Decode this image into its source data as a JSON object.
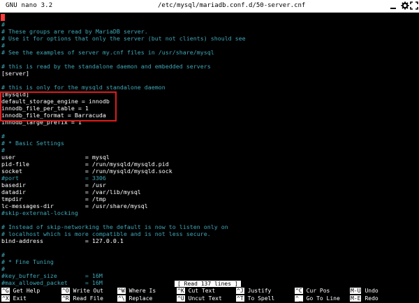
{
  "titlebar": {
    "version": "GNU nano 3.2",
    "file_path": "/etc/mysql/mariadb.conf.d/50-server.cnf"
  },
  "editor": {
    "lines": [
      {
        "text": "#",
        "type": "comment"
      },
      {
        "text": "# These groups are read by MariaDB server.",
        "type": "comment"
      },
      {
        "text": "# Use it for options that only the server (but not clients) should see",
        "type": "comment"
      },
      {
        "text": "#",
        "type": "comment"
      },
      {
        "text": "# See the examples of server my.cnf files in /usr/share/mysql",
        "type": "comment"
      },
      {
        "text": "",
        "type": "blank"
      },
      {
        "text": "# this is read by the standalone daemon and embedded servers",
        "type": "comment"
      },
      {
        "text": "[server]",
        "type": "text"
      },
      {
        "text": "",
        "type": "blank"
      },
      {
        "text": "# this is only for the mysqld standalone daemon",
        "type": "comment"
      },
      {
        "text": "[mysqld]",
        "type": "text"
      },
      {
        "text": "default_storage_engine = innodb",
        "type": "text"
      },
      {
        "text": "innodb_file_per_table = 1",
        "type": "text"
      },
      {
        "text": "innodb_file_format = Barracuda",
        "type": "text"
      },
      {
        "text": "innodb_large_prefix = 1",
        "type": "text"
      },
      {
        "text": "",
        "type": "blank"
      },
      {
        "text": "#",
        "type": "comment"
      },
      {
        "text": "# * Basic Settings",
        "type": "comment"
      },
      {
        "text": "#",
        "type": "comment"
      },
      {
        "text": "user                    = mysql",
        "type": "text"
      },
      {
        "text": "pid-file                = /run/mysqld/mysqld.pid",
        "type": "text"
      },
      {
        "text": "socket                  = /run/mysqld/mysqld.sock",
        "type": "text"
      },
      {
        "text": "#port                   = 3306",
        "type": "comment"
      },
      {
        "text": "basedir                 = /usr",
        "type": "text"
      },
      {
        "text": "datadir                 = /var/lib/mysql",
        "type": "text"
      },
      {
        "text": "tmpdir                  = /tmp",
        "type": "text"
      },
      {
        "text": "lc-messages-dir         = /usr/share/mysql",
        "type": "text"
      },
      {
        "text": "#skip-external-locking",
        "type": "comment"
      },
      {
        "text": "",
        "type": "blank"
      },
      {
        "text": "# Instead of skip-networking the default is now to listen only on",
        "type": "comment"
      },
      {
        "text": "# localhost which is more compatible and is not less secure.",
        "type": "comment"
      },
      {
        "text": "bind-address            = 127.0.0.1",
        "type": "text"
      },
      {
        "text": "",
        "type": "blank"
      },
      {
        "text": "#",
        "type": "comment"
      },
      {
        "text": "# * Fine Tuning",
        "type": "comment"
      },
      {
        "text": "#",
        "type": "comment"
      },
      {
        "text": "#key_buffer_size        = 16M",
        "type": "comment"
      },
      {
        "text": "#max_allowed_packet     = 16M",
        "type": "comment"
      }
    ]
  },
  "status_message": "[ Read 137 lines ]",
  "shortcuts": [
    {
      "key": "^G",
      "label": "Get Help",
      "name": "get-help"
    },
    {
      "key": "^O",
      "label": "Write Out",
      "name": "write-out"
    },
    {
      "key": "^W",
      "label": "Where Is",
      "name": "where-is"
    },
    {
      "key": "^K",
      "label": "Cut Text",
      "name": "cut-text"
    },
    {
      "key": "^J",
      "label": "Justify",
      "name": "justify"
    },
    {
      "key": "^C",
      "label": "Cur Pos",
      "name": "cur-pos"
    },
    {
      "key": "M-U",
      "label": "Undo",
      "name": "undo"
    },
    {
      "key": "^X",
      "label": "Exit",
      "name": "exit"
    },
    {
      "key": "^R",
      "label": "Read File",
      "name": "read-file"
    },
    {
      "key": "^\\",
      "label": "Replace",
      "name": "replace"
    },
    {
      "key": "^U",
      "label": "Uncut Text",
      "name": "uncut-text"
    },
    {
      "key": "^T",
      "label": "To Spell",
      "name": "to-spell"
    },
    {
      "key": "^_",
      "label": "Go To Line",
      "name": "go-to-line"
    },
    {
      "key": "M-E",
      "label": "Redo",
      "name": "redo"
    }
  ],
  "colors": {
    "comment": "#3fa7b8",
    "text": "#ffffff",
    "background": "#000000",
    "highlight_box": "#e01b1b"
  },
  "icons": [
    "minimize-icon",
    "gear-icon",
    "fullscreen-icon"
  ]
}
